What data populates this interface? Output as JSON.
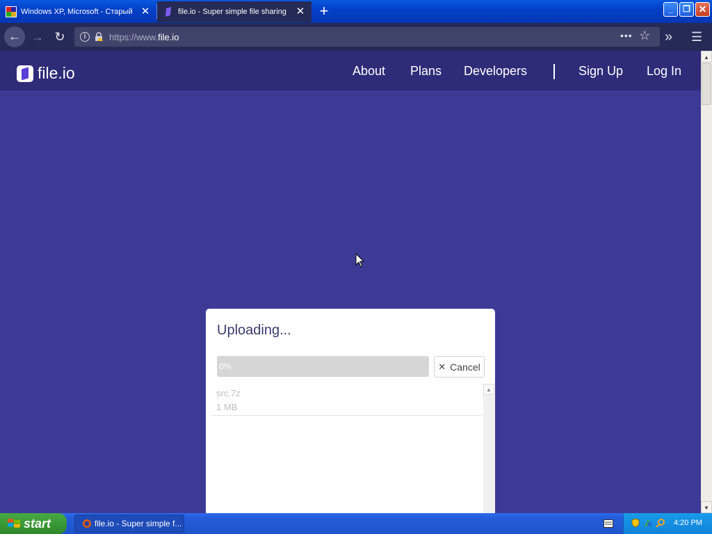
{
  "browser": {
    "tabs": [
      {
        "title": "Windows XP, Microsoft - Старый к",
        "active": false,
        "favicon": "retro-site-icon"
      },
      {
        "title": "file.io - Super simple file sharing",
        "active": true,
        "favicon": "fileio-icon"
      }
    ],
    "url_prefix": "https://www.",
    "url_host": "file.io",
    "icons": {
      "back": "back-icon",
      "forward": "forward-icon",
      "reload": "reload-icon",
      "more": "more-icon",
      "star": "star-icon",
      "overflow": "overflow-icon",
      "menu": "hamburger-icon"
    }
  },
  "site": {
    "logo_text": "file.io",
    "nav": {
      "about": "About",
      "plans": "Plans",
      "developers": "Developers",
      "signup": "Sign Up",
      "login": "Log In"
    }
  },
  "upload": {
    "title": "Uploading...",
    "progress_percent": 0,
    "progress_label": "0%",
    "cancel_label": "Cancel",
    "file": {
      "name": "src.7z",
      "size": "1 MB"
    }
  },
  "taskbar": {
    "start_label": "start",
    "item_label": "file.io - Super simple f...",
    "clock": "4:20 PM"
  },
  "colors": {
    "page_bg": "#3d3a96",
    "header_bg": "#2e2b78",
    "accent": "#5b3fd6"
  }
}
